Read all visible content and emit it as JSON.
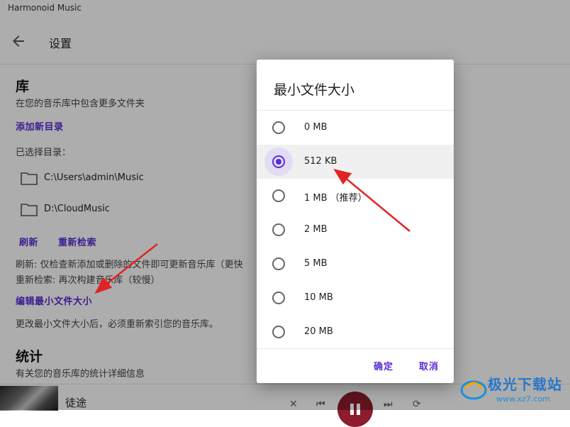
{
  "window": {
    "title": "Harmonoid Music"
  },
  "appbar": {
    "title": "设置",
    "back_icon": "arrow-left-icon"
  },
  "library": {
    "title": "库",
    "subtitle": "在您的音乐库中包含更多文件夹",
    "add_dir": "添加新目录",
    "selected_label": "已选择目录：",
    "folders": [
      "C:\\Users\\admin\\Music",
      "D:\\CloudMusic"
    ],
    "refresh": "刷新",
    "reindex": "重新检索",
    "refresh_desc": "刷新: 仅检查新添加或删除的文件即可更新音乐库（更快",
    "reindex_desc": "重新检索: 再次构建音乐库（较慢）",
    "edit_min_size": "编辑最小文件大小",
    "min_size_desc": "更改最小文件大小后，必须重新索引您的音乐库。"
  },
  "stats": {
    "title": "统计",
    "subtitle": "有关您的音乐库的统计详细信息"
  },
  "player": {
    "track": "徒途"
  },
  "dialog": {
    "title": "最小文件大小",
    "options": [
      "0 MB",
      "512 KB",
      "1 MB （推荐）",
      "2 MB",
      "5 MB",
      "10 MB",
      "20 MB"
    ],
    "selected": "512 KB",
    "confirm": "确定",
    "cancel": "取消"
  },
  "colors": {
    "accent": "#5b2cd6",
    "annotation_arrow": "#e02424",
    "play_button": "#8c1c2e"
  },
  "watermark": {
    "text": "极光下载站",
    "url": "www.xz7.com"
  }
}
